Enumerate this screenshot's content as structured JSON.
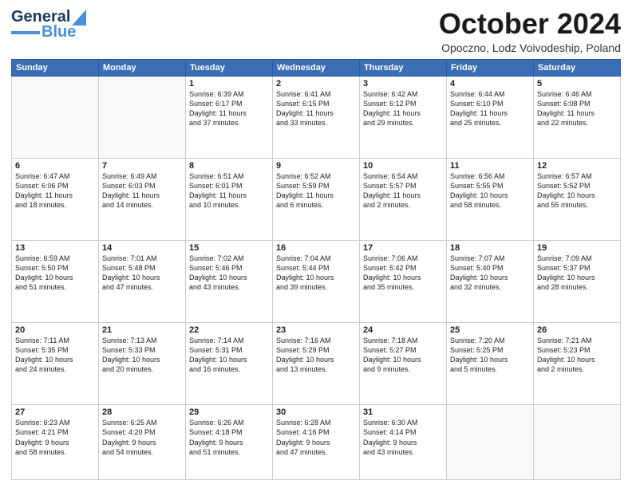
{
  "header": {
    "logo_general": "General",
    "logo_blue": "Blue",
    "month_title": "October 2024",
    "subtitle": "Opoczno, Lodz Voivodeship, Poland"
  },
  "weekdays": [
    "Sunday",
    "Monday",
    "Tuesday",
    "Wednesday",
    "Thursday",
    "Friday",
    "Saturday"
  ],
  "weeks": [
    [
      {
        "day": "",
        "info": ""
      },
      {
        "day": "",
        "info": ""
      },
      {
        "day": "1",
        "info": "Sunrise: 6:39 AM\nSunset: 6:17 PM\nDaylight: 11 hours\nand 37 minutes."
      },
      {
        "day": "2",
        "info": "Sunrise: 6:41 AM\nSunset: 6:15 PM\nDaylight: 11 hours\nand 33 minutes."
      },
      {
        "day": "3",
        "info": "Sunrise: 6:42 AM\nSunset: 6:12 PM\nDaylight: 11 hours\nand 29 minutes."
      },
      {
        "day": "4",
        "info": "Sunrise: 6:44 AM\nSunset: 6:10 PM\nDaylight: 11 hours\nand 25 minutes."
      },
      {
        "day": "5",
        "info": "Sunrise: 6:46 AM\nSunset: 6:08 PM\nDaylight: 11 hours\nand 22 minutes."
      }
    ],
    [
      {
        "day": "6",
        "info": "Sunrise: 6:47 AM\nSunset: 6:06 PM\nDaylight: 11 hours\nand 18 minutes."
      },
      {
        "day": "7",
        "info": "Sunrise: 6:49 AM\nSunset: 6:03 PM\nDaylight: 11 hours\nand 14 minutes."
      },
      {
        "day": "8",
        "info": "Sunrise: 6:51 AM\nSunset: 6:01 PM\nDaylight: 11 hours\nand 10 minutes."
      },
      {
        "day": "9",
        "info": "Sunrise: 6:52 AM\nSunset: 5:59 PM\nDaylight: 11 hours\nand 6 minutes."
      },
      {
        "day": "10",
        "info": "Sunrise: 6:54 AM\nSunset: 5:57 PM\nDaylight: 11 hours\nand 2 minutes."
      },
      {
        "day": "11",
        "info": "Sunrise: 6:56 AM\nSunset: 5:55 PM\nDaylight: 10 hours\nand 58 minutes."
      },
      {
        "day": "12",
        "info": "Sunrise: 6:57 AM\nSunset: 5:52 PM\nDaylight: 10 hours\nand 55 minutes."
      }
    ],
    [
      {
        "day": "13",
        "info": "Sunrise: 6:59 AM\nSunset: 5:50 PM\nDaylight: 10 hours\nand 51 minutes."
      },
      {
        "day": "14",
        "info": "Sunrise: 7:01 AM\nSunset: 5:48 PM\nDaylight: 10 hours\nand 47 minutes."
      },
      {
        "day": "15",
        "info": "Sunrise: 7:02 AM\nSunset: 5:46 PM\nDaylight: 10 hours\nand 43 minutes."
      },
      {
        "day": "16",
        "info": "Sunrise: 7:04 AM\nSunset: 5:44 PM\nDaylight: 10 hours\nand 39 minutes."
      },
      {
        "day": "17",
        "info": "Sunrise: 7:06 AM\nSunset: 5:42 PM\nDaylight: 10 hours\nand 35 minutes."
      },
      {
        "day": "18",
        "info": "Sunrise: 7:07 AM\nSunset: 5:40 PM\nDaylight: 10 hours\nand 32 minutes."
      },
      {
        "day": "19",
        "info": "Sunrise: 7:09 AM\nSunset: 5:37 PM\nDaylight: 10 hours\nand 28 minutes."
      }
    ],
    [
      {
        "day": "20",
        "info": "Sunrise: 7:11 AM\nSunset: 5:35 PM\nDaylight: 10 hours\nand 24 minutes."
      },
      {
        "day": "21",
        "info": "Sunrise: 7:13 AM\nSunset: 5:33 PM\nDaylight: 10 hours\nand 20 minutes."
      },
      {
        "day": "22",
        "info": "Sunrise: 7:14 AM\nSunset: 5:31 PM\nDaylight: 10 hours\nand 16 minutes."
      },
      {
        "day": "23",
        "info": "Sunrise: 7:16 AM\nSunset: 5:29 PM\nDaylight: 10 hours\nand 13 minutes."
      },
      {
        "day": "24",
        "info": "Sunrise: 7:18 AM\nSunset: 5:27 PM\nDaylight: 10 hours\nand 9 minutes."
      },
      {
        "day": "25",
        "info": "Sunrise: 7:20 AM\nSunset: 5:25 PM\nDaylight: 10 hours\nand 5 minutes."
      },
      {
        "day": "26",
        "info": "Sunrise: 7:21 AM\nSunset: 5:23 PM\nDaylight: 10 hours\nand 2 minutes."
      }
    ],
    [
      {
        "day": "27",
        "info": "Sunrise: 6:23 AM\nSunset: 4:21 PM\nDaylight: 9 hours\nand 58 minutes."
      },
      {
        "day": "28",
        "info": "Sunrise: 6:25 AM\nSunset: 4:20 PM\nDaylight: 9 hours\nand 54 minutes."
      },
      {
        "day": "29",
        "info": "Sunrise: 6:26 AM\nSunset: 4:18 PM\nDaylight: 9 hours\nand 51 minutes."
      },
      {
        "day": "30",
        "info": "Sunrise: 6:28 AM\nSunset: 4:16 PM\nDaylight: 9 hours\nand 47 minutes."
      },
      {
        "day": "31",
        "info": "Sunrise: 6:30 AM\nSunset: 4:14 PM\nDaylight: 9 hours\nand 43 minutes."
      },
      {
        "day": "",
        "info": ""
      },
      {
        "day": "",
        "info": ""
      }
    ]
  ]
}
